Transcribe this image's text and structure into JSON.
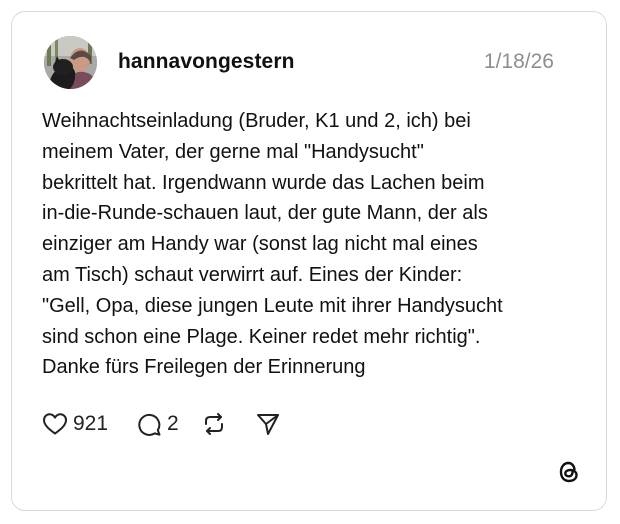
{
  "post": {
    "author": {
      "username": "hannavongestern",
      "avatar_icon": "profile-photo"
    },
    "timestamp": "1/18/26",
    "text": "Weihnachtseinladung (Bruder, K1 und 2, ich) bei\nmeinem Vater, der gerne mal \"Handysucht\"\nbekrittelt hat.  Irgendwann wurde das Lachen beim\nin-die-Runde-schauen laut, der gute Mann, der als\neinziger am Handy war (sonst lag nicht mal eines\nam Tisch) schaut verwirrt auf. Eines der Kinder:\n\"Gell, Opa, diese jungen Leute mit ihrer Handysucht\nsind schon eine Plage. Keiner redet mehr richtig\".\nDanke fürs Freilegen der Erinnerung",
    "actions": {
      "like": {
        "icon": "heart-icon",
        "count": "921"
      },
      "reply": {
        "icon": "speech-bubble-icon",
        "count": "2"
      },
      "repost": {
        "icon": "repost-icon"
      },
      "share": {
        "icon": "send-icon"
      }
    },
    "brand_icon": "threads-logo"
  },
  "colors": {
    "text": "#111111",
    "muted": "#8e8e8e",
    "border": "#d9d9d9",
    "background": "#ffffff"
  }
}
